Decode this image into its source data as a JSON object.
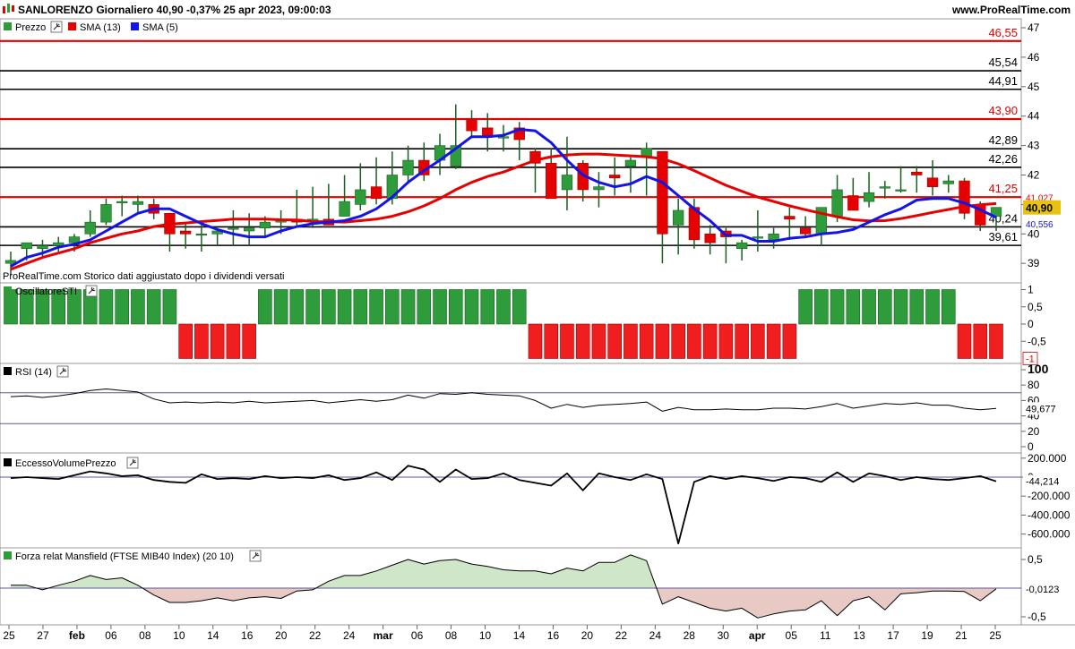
{
  "header": {
    "title": "SANLORENZO Giornaliero 40,90 -0,37% 25 apr 2023, 09:00:03",
    "brand": "www.ProRealTime.com"
  },
  "footnote": "ProRealTime.com Storico dati aggiustato dopo i dividendi versati",
  "panels": {
    "price": {
      "legend": [
        {
          "label": "Prezzo",
          "color": "#2e9c3b",
          "icon": "wrench-icon"
        },
        {
          "label": "SMA (13)",
          "color": "#e60000"
        },
        {
          "label": "SMA (5)",
          "color": "#1414e6"
        }
      ],
      "axis_ticks": [
        "47",
        "46",
        "45",
        "44",
        "43",
        "42",
        "41",
        "40",
        "39"
      ],
      "levels": [
        {
          "value": 46.55,
          "label": "46,55",
          "color": "#e60000"
        },
        {
          "value": 45.54,
          "label": "45,54",
          "color": "#000000"
        },
        {
          "value": 44.91,
          "label": "44,91",
          "color": "#000000"
        },
        {
          "value": 43.9,
          "label": "43,90",
          "color": "#e60000"
        },
        {
          "value": 42.89,
          "label": "42,89",
          "color": "#000000"
        },
        {
          "value": 42.26,
          "label": "42,26",
          "color": "#000000"
        },
        {
          "value": 41.25,
          "label": "41,25",
          "color": "#e60000"
        },
        {
          "value": 40.24,
          "label": "40,24",
          "color": "#000000"
        },
        {
          "value": 39.61,
          "label": "39,61",
          "color": "#000000"
        }
      ],
      "tags": [
        {
          "value": 41.027,
          "label": "41,027",
          "color": "#e60000",
          "boxed": false
        },
        {
          "value": 40.9,
          "label": "40,90",
          "color": "#e8c210",
          "boxed": true
        },
        {
          "value": 40.556,
          "label": "40,556",
          "color": "#1414e6",
          "boxed": false
        }
      ]
    },
    "sti": {
      "title": "OscillatoreSTI",
      "axis_ticks": [
        "1",
        "0,5",
        "0",
        "-0,5"
      ],
      "last_label": "-1"
    },
    "rsi": {
      "title": "RSI (14)",
      "axis_ticks": [
        "100",
        "80",
        "60",
        "40",
        "20",
        "0"
      ],
      "last_label": "49,677"
    },
    "evp": {
      "title": "EccessoVolumePrezzo",
      "axis_ticks": [
        "200.000",
        "0",
        "-200.000",
        "-400.000",
        "-600.000"
      ],
      "last_label": "-44,214"
    },
    "mansfield": {
      "title": "Forza relat Mansfield (FTSE MIB40 Index) (20 10)",
      "axis_ticks": [
        "0,5",
        "0",
        "-0,5"
      ],
      "last_label": "-0,0123"
    }
  },
  "x_axis_labels": [
    "25",
    "27",
    "feb",
    "06",
    "08",
    "10",
    "14",
    "16",
    "20",
    "22",
    "24",
    "mar",
    "06",
    "08",
    "10",
    "14",
    "16",
    "20",
    "22",
    "24",
    "28",
    "30",
    "apr",
    "05",
    "11",
    "13",
    "17",
    "19",
    "21",
    "25"
  ],
  "chart_data": [
    {
      "type": "candlestick",
      "title": "SANLORENZO Giornaliero",
      "dates": [
        "2023-01-25",
        "2023-01-26",
        "2023-01-27",
        "2023-01-30",
        "2023-01-31",
        "2023-02-01",
        "2023-02-02",
        "2023-02-03",
        "2023-02-06",
        "2023-02-07",
        "2023-02-08",
        "2023-02-09",
        "2023-02-10",
        "2023-02-13",
        "2023-02-14",
        "2023-02-15",
        "2023-02-16",
        "2023-02-17",
        "2023-02-20",
        "2023-02-21",
        "2023-02-22",
        "2023-02-23",
        "2023-02-24",
        "2023-02-27",
        "2023-02-28",
        "2023-03-01",
        "2023-03-02",
        "2023-03-03",
        "2023-03-06",
        "2023-03-07",
        "2023-03-08",
        "2023-03-09",
        "2023-03-10",
        "2023-03-13",
        "2023-03-14",
        "2023-03-15",
        "2023-03-16",
        "2023-03-17",
        "2023-03-20",
        "2023-03-21",
        "2023-03-22",
        "2023-03-23",
        "2023-03-24",
        "2023-03-27",
        "2023-03-28",
        "2023-03-29",
        "2023-03-30",
        "2023-03-31",
        "2023-04-03",
        "2023-04-04",
        "2023-04-05",
        "2023-04-06",
        "2023-04-11",
        "2023-04-12",
        "2023-04-13",
        "2023-04-14",
        "2023-04-17",
        "2023-04-18",
        "2023-04-19",
        "2023-04-20",
        "2023-04-21",
        "2023-04-24",
        "2023-04-25"
      ],
      "open": [
        39.0,
        39.5,
        39.5,
        39.6,
        39.7,
        40.0,
        40.4,
        41.1,
        41.0,
        41.0,
        40.7,
        40.1,
        40.0,
        40.0,
        40.2,
        40.1,
        40.2,
        40.4,
        40.5,
        40.4,
        40.5,
        40.6,
        41.0,
        41.6,
        41.2,
        42.0,
        42.5,
        42.5,
        42.3,
        43.9,
        43.6,
        43.3,
        43.6,
        42.8,
        42.4,
        41.5,
        42.4,
        41.5,
        42.0,
        42.3,
        42.6,
        42.8,
        40.3,
        40.9,
        40.0,
        40.1,
        39.5,
        39.9,
        39.8,
        40.6,
        40.2,
        40.0,
        40.6,
        41.3,
        41.1,
        41.6,
        41.5,
        42.1,
        41.9,
        41.7,
        41.8,
        41.0,
        40.6
      ],
      "high": [
        39.4,
        39.7,
        39.8,
        39.9,
        40.0,
        40.8,
        41.2,
        41.3,
        41.3,
        41.2,
        40.7,
        40.4,
        40.3,
        40.2,
        40.8,
        40.7,
        40.6,
        40.8,
        41.5,
        41.6,
        41.7,
        42.0,
        42.4,
        42.6,
        42.8,
        43.0,
        43.1,
        43.4,
        44.4,
        44.2,
        44.1,
        43.7,
        43.8,
        42.9,
        42.9,
        43.3,
        42.5,
        42.1,
        42.6,
        42.6,
        43.1,
        42.8,
        41.2,
        41.2,
        40.3,
        40.2,
        39.8,
        40.8,
        40.2,
        40.9,
        40.6,
        40.9,
        42.0,
        41.9,
        42.1,
        41.8,
        42.3,
        42.3,
        42.5,
        42.0,
        41.9,
        41.1,
        40.9
      ],
      "low": [
        38.6,
        39.1,
        39.2,
        39.4,
        39.4,
        39.9,
        40.3,
        40.6,
        40.7,
        40.5,
        39.4,
        39.5,
        39.4,
        39.6,
        39.6,
        39.6,
        39.9,
        40.0,
        40.3,
        40.2,
        40.3,
        40.6,
        40.8,
        41.0,
        41.0,
        41.7,
        41.8,
        42.0,
        42.2,
        43.3,
        42.8,
        42.8,
        42.5,
        41.4,
        41.2,
        40.8,
        41.1,
        40.9,
        41.3,
        41.4,
        41.3,
        39.0,
        39.3,
        39.5,
        39.3,
        39.0,
        39.1,
        39.4,
        39.5,
        39.8,
        39.9,
        39.6,
        40.4,
        40.8,
        40.9,
        41.2,
        41.4,
        41.4,
        41.3,
        41.4,
        40.5,
        40.1,
        40.1
      ],
      "close": [
        39.1,
        39.7,
        39.6,
        39.7,
        39.9,
        40.4,
        41.0,
        41.1,
        41.1,
        40.7,
        40.0,
        40.0,
        40.0,
        40.1,
        40.2,
        40.2,
        40.4,
        40.5,
        40.4,
        40.5,
        40.3,
        41.1,
        41.5,
        41.2,
        42.0,
        42.5,
        42.0,
        43.0,
        43.0,
        43.5,
        43.3,
        43.3,
        43.2,
        42.4,
        41.2,
        42.0,
        41.5,
        41.6,
        41.9,
        42.5,
        42.9,
        40.0,
        40.8,
        39.8,
        39.7,
        39.9,
        39.7,
        39.9,
        40.0,
        40.5,
        40.0,
        40.9,
        41.5,
        40.8,
        41.4,
        41.6,
        41.5,
        42.0,
        41.6,
        41.8,
        40.7,
        40.3,
        40.9
      ],
      "sma13": [
        38.8,
        39.0,
        39.2,
        39.35,
        39.5,
        39.7,
        39.85,
        40.0,
        40.1,
        40.25,
        40.33,
        40.37,
        40.42,
        40.46,
        40.5,
        40.5,
        40.5,
        40.48,
        40.47,
        40.42,
        40.41,
        40.4,
        40.45,
        40.5,
        40.6,
        40.75,
        40.95,
        41.2,
        41.5,
        41.75,
        41.95,
        42.1,
        42.3,
        42.5,
        42.62,
        42.68,
        42.71,
        42.71,
        42.68,
        42.65,
        42.62,
        42.55,
        42.38,
        42.15,
        41.9,
        41.65,
        41.45,
        41.25,
        41.1,
        40.95,
        40.82,
        40.7,
        40.58,
        40.48,
        40.44,
        40.45,
        40.52,
        40.62,
        40.73,
        40.83,
        40.93,
        40.99,
        41.03
      ],
      "sma5": [
        38.9,
        39.2,
        39.35,
        39.55,
        39.65,
        39.8,
        40.1,
        40.4,
        40.7,
        40.85,
        40.85,
        40.6,
        40.35,
        40.15,
        40.0,
        39.9,
        39.9,
        40.1,
        40.25,
        40.35,
        40.4,
        40.45,
        40.6,
        40.85,
        41.25,
        41.75,
        42.15,
        42.5,
        42.9,
        43.3,
        43.3,
        43.35,
        43.55,
        43.5,
        43.1,
        42.5,
        42.0,
        41.75,
        41.6,
        41.7,
        41.95,
        41.75,
        41.3,
        40.85,
        40.45,
        39.95,
        39.95,
        39.75,
        39.75,
        39.85,
        39.9,
        40.0,
        40.05,
        40.15,
        40.4,
        40.65,
        40.85,
        41.15,
        41.2,
        41.2,
        41.05,
        40.82,
        40.56
      ],
      "ylim": [
        38.5,
        47.0
      ]
    },
    {
      "type": "bar",
      "title": "OscillatoreSTI",
      "values": [
        1,
        1,
        1,
        1,
        1,
        1,
        1,
        1,
        1,
        1,
        1,
        -1,
        -1,
        -1,
        -1,
        -1,
        1,
        1,
        1,
        1,
        1,
        1,
        1,
        1,
        1,
        1,
        1,
        1,
        1,
        1,
        1,
        1,
        1,
        -1,
        -1,
        -1,
        -1,
        -1,
        -1,
        -1,
        -1,
        -1,
        -1,
        -1,
        -1,
        -1,
        -1,
        -1,
        -1,
        -1,
        1,
        1,
        1,
        1,
        1,
        1,
        1,
        1,
        1,
        1,
        -1,
        -1,
        -1
      ],
      "ylim": [
        -1,
        1
      ]
    },
    {
      "type": "line",
      "title": "RSI (14)",
      "values": [
        65,
        66,
        64,
        66,
        69,
        73,
        75,
        73,
        71,
        62,
        57,
        58,
        57,
        58,
        57,
        59,
        57,
        58,
        59,
        60,
        57,
        59,
        61,
        59,
        61,
        67,
        63,
        69,
        68,
        70,
        68,
        67,
        66,
        60,
        50,
        55,
        51,
        54,
        55,
        56,
        58,
        46,
        51,
        48,
        48,
        49,
        48,
        48,
        50,
        50,
        49,
        52,
        56,
        50,
        53,
        56,
        55,
        57,
        54,
        54,
        50,
        48,
        49.677
      ],
      "ylim": [
        0,
        100
      ],
      "reference_lines": [
        70,
        30
      ]
    },
    {
      "type": "line",
      "title": "EccessoVolumePrezzo",
      "values": [
        -10000,
        0,
        -10000,
        -20000,
        20000,
        60000,
        40000,
        10000,
        20000,
        -30000,
        -50000,
        -60000,
        30000,
        -20000,
        -10000,
        -20000,
        10000,
        -10000,
        0,
        -10000,
        20000,
        -30000,
        -10000,
        50000,
        -30000,
        120000,
        80000,
        -50000,
        80000,
        -20000,
        -10000,
        40000,
        -30000,
        -60000,
        -90000,
        40000,
        -140000,
        40000,
        0,
        -30000,
        30000,
        -20000,
        -700000,
        -50000,
        10000,
        -20000,
        10000,
        -10000,
        -40000,
        0,
        -10000,
        -50000,
        50000,
        -50000,
        40000,
        10000,
        -30000,
        0,
        -20000,
        -30000,
        -10000,
        10000,
        -44214
      ],
      "ylim": [
        -700000,
        200000
      ]
    },
    {
      "type": "area",
      "title": "Forza relat Mansfield (FTSE MIB40 Index) (20 10)",
      "values": [
        0.05,
        0.05,
        -0.03,
        0.05,
        0.12,
        0.22,
        0.15,
        0.18,
        0.05,
        -0.12,
        -0.25,
        -0.25,
        -0.22,
        -0.17,
        -0.22,
        -0.17,
        -0.15,
        -0.18,
        -0.05,
        -0.03,
        0.12,
        0.22,
        0.22,
        0.3,
        0.4,
        0.5,
        0.42,
        0.48,
        0.5,
        0.42,
        0.38,
        0.32,
        0.3,
        0.3,
        0.25,
        0.35,
        0.3,
        0.45,
        0.45,
        0.58,
        0.48,
        -0.28,
        -0.15,
        -0.25,
        -0.35,
        -0.4,
        -0.35,
        -0.52,
        -0.45,
        -0.4,
        -0.38,
        -0.22,
        -0.48,
        -0.22,
        -0.15,
        -0.38,
        -0.1,
        -0.08,
        -0.05,
        -0.05,
        -0.06,
        -0.22,
        -0.0123
      ],
      "ylim": [
        -0.7,
        0.7
      ]
    }
  ]
}
